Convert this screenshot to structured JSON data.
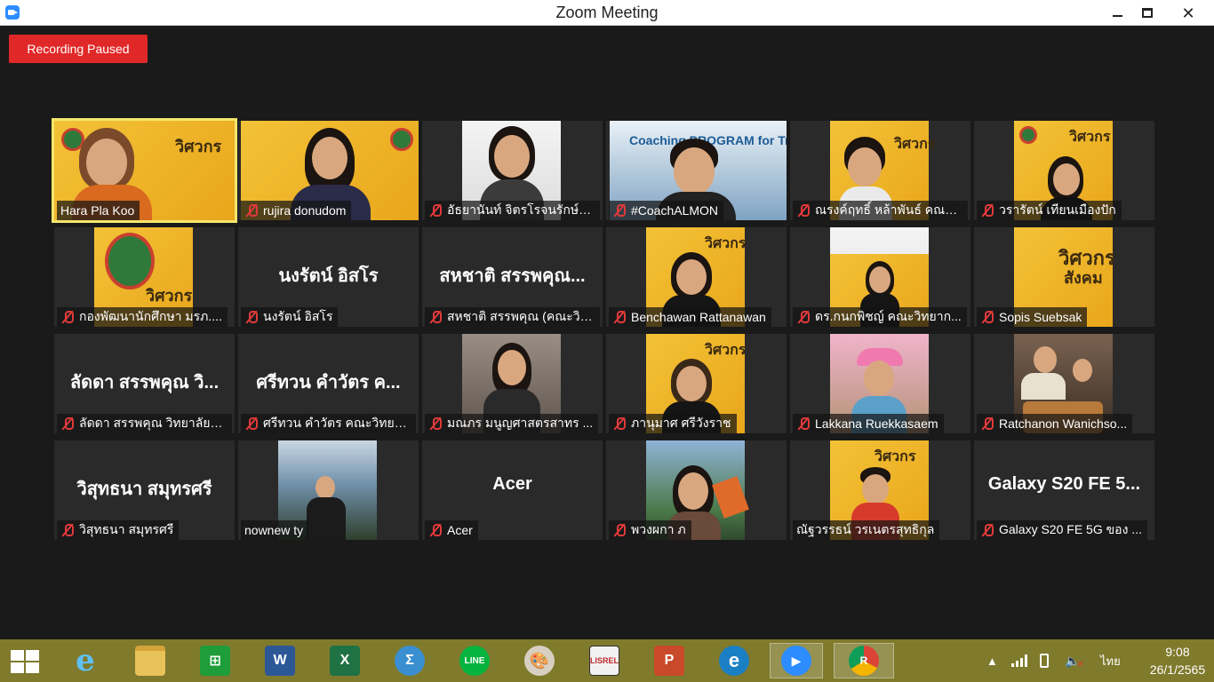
{
  "window": {
    "title": "Zoom Meeting"
  },
  "recording": {
    "label": "Recording Paused"
  },
  "participants": [
    {
      "name": "Hara Pla Koo",
      "muted": false,
      "active": true
    },
    {
      "name": "rujira donudom",
      "muted": true
    },
    {
      "name": "อัธยานันท์ จิตรโรจนรักษ์ ค...",
      "muted": true
    },
    {
      "name": "#CoachALMON",
      "muted": true,
      "video_text": "Coaching PROGRAM for Trainer"
    },
    {
      "name": "ณรงค์ฤทธิ์ หล้าพันธ์ คณะว...",
      "muted": true
    },
    {
      "name": "วรารัตน์ เทียนเมืองปัก",
      "muted": true
    },
    {
      "name": "กองพัฒนานักศึกษา มรภ....",
      "muted": true
    },
    {
      "name": "นงรัตน์ อิสโร",
      "muted": true,
      "display_name": "นงรัตน์ อิสโร"
    },
    {
      "name": "สหชาติ สรรพคุณ (คณะวิท...",
      "muted": true,
      "display_name": "สหชาติ สรรพคุณ..."
    },
    {
      "name": "Benchawan Rattanawan",
      "muted": true
    },
    {
      "name": "ดร.กนกพิชญ์ คณะวิทยาก...",
      "muted": true
    },
    {
      "name": "Sopis Suebsak",
      "muted": true
    },
    {
      "name": "ลัดดา สรรพคุณ วิทยาลัยก...",
      "muted": true,
      "display_name": "ลัดดา สรรพคุณ วิ..."
    },
    {
      "name": "ศรีทวน  คำวัตร คณะวิทยา...",
      "muted": true,
      "display_name": "ศรีทวน  คำวัตร ค..."
    },
    {
      "name": "มณภร มนูญศาสตรสาทร ...",
      "muted": true
    },
    {
      "name": "ภานุมาศ ศรีวังราช",
      "muted": true
    },
    {
      "name": "Lakkana Ruekkasaem",
      "muted": true
    },
    {
      "name": "Ratchanon Wanichso...",
      "muted": true
    },
    {
      "name": "วิสุทธนา สมุทรศรี",
      "muted": true,
      "display_name": "วิสุทธนา สมุทรศรี"
    },
    {
      "name": "nownew ty",
      "muted": false
    },
    {
      "name": "Acer",
      "muted": true,
      "display_name": "Acer"
    },
    {
      "name": "พวงผกา ภ",
      "muted": true
    },
    {
      "name": "ณัฐวรรธน์ วรเนตรสุทธิกุล",
      "muted": false
    },
    {
      "name": "Galaxy S20 FE 5G ของ ...",
      "muted": true,
      "display_name": "Galaxy S20 FE 5..."
    }
  ],
  "poster_text": {
    "line1": "วิศวกร",
    "line2": "สังคม"
  },
  "taskbar": {
    "apps": [
      {
        "icon": "internet-explorer-icon",
        "glyph": "e",
        "color": "#1e90d8"
      },
      {
        "icon": "file-explorer-icon",
        "glyph": "",
        "color": "#e8c35a"
      },
      {
        "icon": "store-icon",
        "glyph": "⊞",
        "color": "#1f9d3a"
      },
      {
        "icon": "word-icon",
        "glyph": "W",
        "color": "#2b5797"
      },
      {
        "icon": "excel-icon",
        "glyph": "X",
        "color": "#1f7244"
      },
      {
        "icon": "math-input-icon",
        "glyph": "Σ",
        "color": "#3a8fd0"
      },
      {
        "icon": "line-icon",
        "glyph": "LINE",
        "color": "#05b33f"
      },
      {
        "icon": "paint-icon",
        "glyph": "🎨",
        "color": "#d7d0c2"
      },
      {
        "icon": "lisrel-icon",
        "glyph": "LISREL",
        "color": "#f2f2f2"
      },
      {
        "icon": "powerpoint-icon",
        "glyph": "P",
        "color": "#c94a2a"
      },
      {
        "icon": "edge-icon",
        "glyph": "e",
        "color": "#1b7fc4"
      },
      {
        "icon": "zoom-icon",
        "glyph": "▶",
        "color": "#2d8cff"
      },
      {
        "icon": "chrome-icon",
        "glyph": "R",
        "color": "#dd4b39"
      }
    ],
    "language": "ไทย",
    "time": "9:08",
    "date": "26/1/2565"
  }
}
